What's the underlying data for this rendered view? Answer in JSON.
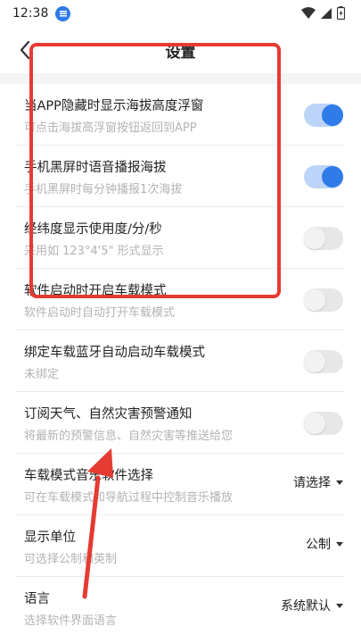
{
  "status_bar": {
    "time": "12:38"
  },
  "header": {
    "title": "设置"
  },
  "items": [
    {
      "title": "当APP隐藏时显示海拔高度浮窗",
      "subtitle": "可点击海拔高浮窗按钮返回到APP",
      "control": "toggle",
      "on": true
    },
    {
      "title": "手机黑屏时语音播报海拔",
      "subtitle": "手机黑屏时每分钟播报1次海拔",
      "control": "toggle",
      "on": true
    },
    {
      "title": "经纬度显示使用度/分/秒",
      "subtitle": "采用如 123°4'5\" 形式显示",
      "control": "toggle",
      "on": false
    },
    {
      "title": "软件启动时开启车载模式",
      "subtitle": "软件启动时自动打开车载模式",
      "control": "toggle",
      "on": false
    },
    {
      "title": "绑定车载蓝牙自动启动车载模式",
      "subtitle": "未绑定",
      "control": "toggle",
      "on": false
    },
    {
      "title": "订阅天气、自然灾害预警通知",
      "subtitle": "将最新的预警信息、自然灾害等推送给您",
      "control": "toggle",
      "on": false
    },
    {
      "title": "车载模式音乐软件选择",
      "subtitle": "可在车载模式和导航过程中控制音乐播放",
      "control": "select",
      "value": "请选择"
    },
    {
      "title": "显示单位",
      "subtitle": "可选择公制和英制",
      "control": "select",
      "value": "公制"
    },
    {
      "title": "语言",
      "subtitle": "选择软件界面语言",
      "control": "select",
      "value": "系统默认"
    }
  ],
  "colors": {
    "accent": "#2f7be8",
    "annotation": "#e53b32"
  }
}
